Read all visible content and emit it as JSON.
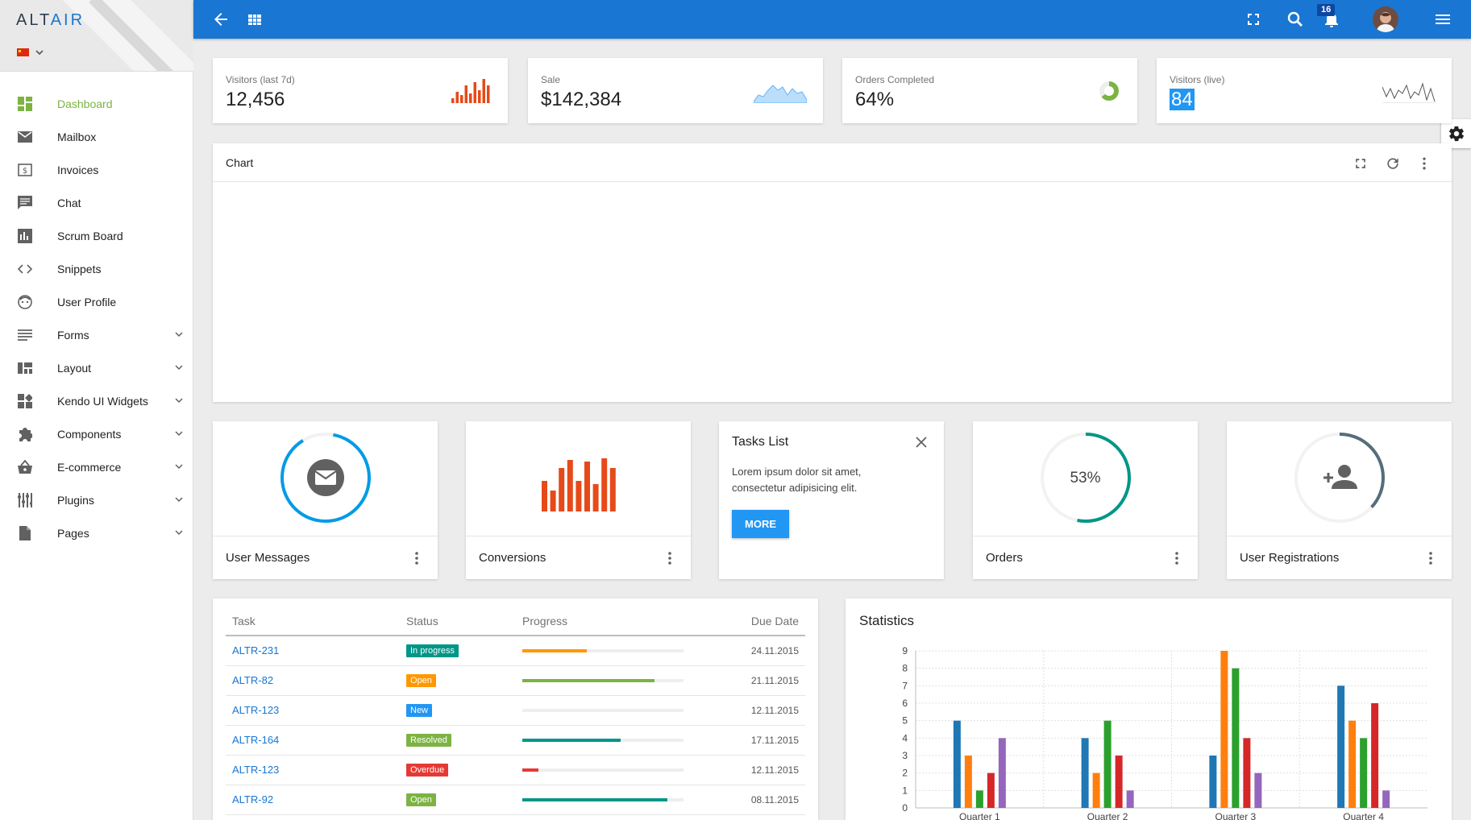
{
  "logo": {
    "part1": "ALT",
    "part2": "AIR"
  },
  "sidebar": {
    "items": [
      {
        "label": "Dashboard",
        "icon": "dashboard-icon",
        "active": true
      },
      {
        "label": "Mailbox",
        "icon": "mail-icon"
      },
      {
        "label": "Invoices",
        "icon": "invoice-icon"
      },
      {
        "label": "Chat",
        "icon": "chat-icon"
      },
      {
        "label": "Scrum Board",
        "icon": "scrum-board-icon"
      },
      {
        "label": "Snippets",
        "icon": "code-icon"
      },
      {
        "label": "User Profile",
        "icon": "face-icon"
      },
      {
        "label": "Forms",
        "icon": "forms-icon",
        "expandable": true
      },
      {
        "label": "Layout",
        "icon": "layout-icon",
        "expandable": true
      },
      {
        "label": "Kendo UI Widgets",
        "icon": "widgets-icon",
        "expandable": true
      },
      {
        "label": "Components",
        "icon": "puzzle-icon",
        "expandable": true
      },
      {
        "label": "E-commerce",
        "icon": "basket-icon",
        "expandable": true
      },
      {
        "label": "Plugins",
        "icon": "equalizer-icon",
        "expandable": true
      },
      {
        "label": "Pages",
        "icon": "page-icon",
        "expandable": true
      }
    ]
  },
  "header": {
    "notifications": "16"
  },
  "stats": [
    {
      "label": "Visitors (last 7d)",
      "value": "12,456"
    },
    {
      "label": "Sale",
      "value": "$142,384"
    },
    {
      "label": "Orders Completed",
      "value": "64%"
    },
    {
      "label": "Visitors (live)",
      "value": "84"
    }
  ],
  "chart_card": {
    "title": "Chart"
  },
  "mini_cards": {
    "messages": "User Messages",
    "conversions": "Conversions",
    "orders": "Orders",
    "orders_percent": "53%",
    "registrations": "User Registrations"
  },
  "tasks_card": {
    "title": "Tasks List",
    "description": "Lorem ipsum dolor sit amet, consectetur adipisicing elit.",
    "button": "MORE"
  },
  "task_table": {
    "headers": [
      "Task",
      "Status",
      "Progress",
      "Due Date"
    ],
    "rows": [
      {
        "task": "ALTR-231",
        "status": "In progress",
        "color": "#009688",
        "progress": 40,
        "bar": "#ff9800",
        "due": "24.11.2015"
      },
      {
        "task": "ALTR-82",
        "status": "Open",
        "color": "#ff9800",
        "progress": 82,
        "bar": "#7cb342",
        "due": "21.11.2015"
      },
      {
        "task": "ALTR-123",
        "status": "New",
        "color": "#2196f3",
        "progress": 0,
        "bar": "#2196f3",
        "due": "12.11.2015"
      },
      {
        "task": "ALTR-164",
        "status": "Resolved",
        "color": "#7cb342",
        "progress": 61,
        "bar": "#009688",
        "due": "17.11.2015"
      },
      {
        "task": "ALTR-123",
        "status": "Overdue",
        "color": "#e53935",
        "progress": 10,
        "bar": "#e53935",
        "due": "12.11.2015"
      },
      {
        "task": "ALTR-92",
        "status": "Open",
        "color": "#7cb342",
        "progress": 90,
        "bar": "#009688",
        "due": "08.11.2015"
      }
    ]
  },
  "statistics": {
    "title": "Statistics"
  },
  "chart_data": {
    "type": "bar",
    "categories": [
      "Quarter 1",
      "Quarter 2",
      "Quarter 3",
      "Quarter 4"
    ],
    "series": [
      {
        "values": [
          5,
          4,
          3,
          7
        ],
        "color": "#1f77b4"
      },
      {
        "values": [
          3,
          2,
          9,
          5
        ],
        "color": "#ff7f0e"
      },
      {
        "values": [
          1,
          5,
          8,
          4
        ],
        "color": "#2ca02c"
      },
      {
        "values": [
          2,
          3,
          4,
          6
        ],
        "color": "#d62728"
      },
      {
        "values": [
          4,
          1,
          2,
          1
        ],
        "color": "#9467bd"
      }
    ],
    "ylim": [
      0,
      9
    ],
    "yticks": [
      "0",
      "1",
      "2",
      "3",
      "4",
      "5",
      "6",
      "7",
      "8",
      "9"
    ],
    "grid": true
  }
}
